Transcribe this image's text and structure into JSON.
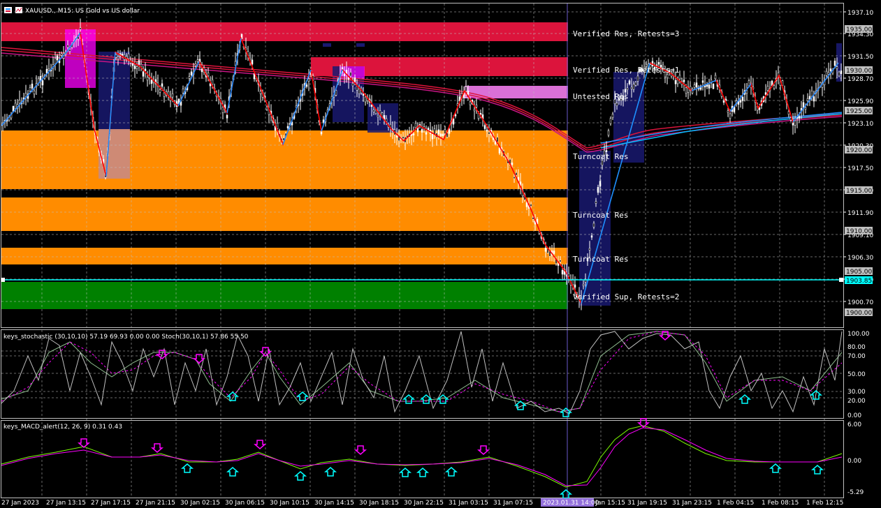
{
  "header": {
    "symbol": "XAUUSD., M15: US Gold vs US dollar"
  },
  "price_axis": {
    "labels": [
      "1937.10",
      "1934.30",
      "1931.50",
      "1928.70",
      "1925.90",
      "1923.10",
      "1920.30",
      "1917.50",
      "1914.70",
      "1911.90",
      "1909.10",
      "1906.30",
      "1903.50",
      "1900.70"
    ],
    "marks": [
      "1935.00",
      "1930.00",
      "1925.00",
      "1920.00",
      "1915.00",
      "1910.00",
      "1905.00",
      "1900.00"
    ],
    "current": "1903.85"
  },
  "zones": [
    {
      "label": "Verified Res, Retests=3",
      "color": "#dc143c"
    },
    {
      "label": "Verified Res, Retests=1",
      "color": "#dc143c"
    },
    {
      "label": "Untested Res",
      "color": "#da70d6"
    },
    {
      "label": "Turncoat Res",
      "color": "#ff8c00"
    },
    {
      "label": "Turncoat Res",
      "color": "#ff8c00"
    },
    {
      "label": "Turncoat Res",
      "color": "#ff8c00"
    },
    {
      "label": "Verified Sup, Retests=2",
      "color": "#008000"
    }
  ],
  "stoch_panel": {
    "title": "keys_stochastic (30,10,10) 57.19 69.93 0.00 0.00  Stoch(30,10,1) 57.86 55.50",
    "levels": [
      "100.00",
      "80.00",
      "70.00",
      "50.00",
      "30.00",
      "20.00",
      "0.00"
    ]
  },
  "macd_panel": {
    "title": "keys_MACD_alert(12, 26, 9) 0.31 0.43",
    "levels": [
      "6.00",
      "0.00",
      "-5.29"
    ]
  },
  "time_axis": {
    "labels": [
      "27 Jan 2023",
      "27 Jan 13:15",
      "27 Jan 17:15",
      "27 Jan 21:15",
      "30 Jan 02:15",
      "30 Jan 06:15",
      "30 Jan 10:15",
      "30 Jan 14:15",
      "30 Jan 18:15",
      "30 Jan 22:15",
      "31 Jan 03:15",
      "31 Jan 07:15",
      "31 Jan 15:15",
      "31 Jan 19:15",
      "31 Jan 23:15",
      "1 Feb 04:15",
      "1 Feb 08:15",
      "1 Feb 12:15"
    ],
    "cursor": "2023.01.31 14:00"
  },
  "colors": {
    "background": "#000000",
    "grid": "#c0c0c0",
    "ma_red": "#dc143c",
    "ma_blue": "#1e90ff",
    "zigzag": "#ff0000",
    "current_line": "#00ffff"
  }
}
